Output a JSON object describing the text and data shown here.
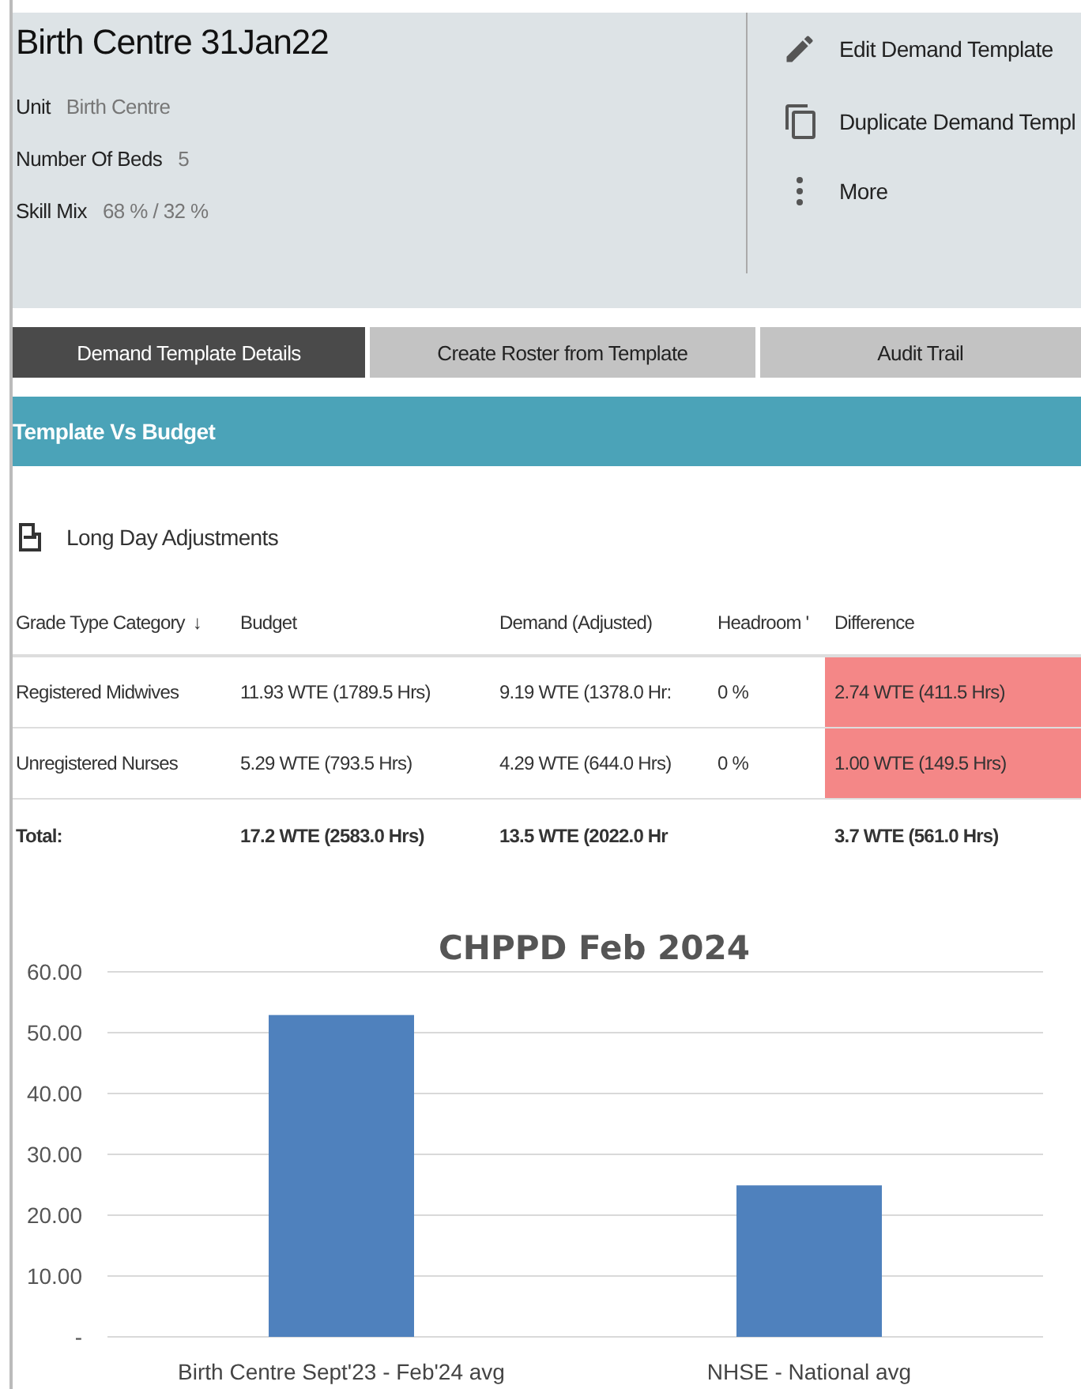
{
  "header": {
    "title": "Birth Centre 31Jan22",
    "fields": [
      {
        "label": "Unit",
        "value": "Birth Centre"
      },
      {
        "label": "Number Of Beds",
        "value": "5"
      },
      {
        "label": "Skill Mix",
        "value": "68 % / 32 %"
      }
    ],
    "actions": [
      {
        "kind": "edit",
        "label": "Edit Demand Template"
      },
      {
        "kind": "duplicate",
        "label": "Duplicate Demand Templ"
      },
      {
        "kind": "more",
        "label": "More"
      }
    ]
  },
  "tabs": [
    {
      "label": "Demand Template Details",
      "selected": true
    },
    {
      "label": "Create Roster from Template",
      "selected": false
    },
    {
      "label": "Audit Trail",
      "selected": false
    }
  ],
  "section": {
    "title": "Template Vs Budget",
    "toggle": "Long Day Adjustments"
  },
  "table": {
    "columns": [
      "Grade Type Category",
      "Budget",
      "Demand (Adjusted)",
      "Headroom '",
      "Difference"
    ],
    "sort_arrow": "↓",
    "rows": [
      {
        "cells": [
          "Registered Midwives",
          "11.93 WTE (1789.5 Hrs)",
          "9.19 WTE (1378.0 Hr:",
          "0 %",
          "2.74 WTE (411.5 Hrs)"
        ],
        "highlighted": true
      },
      {
        "cells": [
          "Unregistered Nurses",
          "5.29 WTE (793.5 Hrs)",
          "4.29 WTE (644.0 Hrs)",
          "0 %",
          "1.00 WTE (149.5 Hrs)"
        ],
        "highlighted": true
      }
    ],
    "total": {
      "label": "Total:",
      "budget": "17.2 WTE (2583.0 Hrs)",
      "demand": "13.5 WTE (2022.0 Hr",
      "difference": "3.7 WTE (561.0 Hrs)"
    }
  },
  "chart": {
    "chart_data": {
      "type": "bar",
      "title": "CHPPD Feb 2024",
      "categories": [
        "Birth Centre Sept'23 - Feb'24 avg",
        "NHSE - National avg"
      ],
      "series": [
        {
          "color": "#4f81bd",
          "values": [
            52.9,
            24.9
          ]
        }
      ],
      "ylim": [
        0,
        60
      ],
      "grid": true,
      "yticks": [
        {
          "value": 0,
          "label": "-"
        },
        {
          "value": 10,
          "label": "10.00"
        },
        {
          "value": 20,
          "label": "20.00"
        },
        {
          "value": 30,
          "label": "30.00"
        },
        {
          "value": 40,
          "label": "40.00"
        },
        {
          "value": 50,
          "label": "50.00"
        },
        {
          "value": 60,
          "label": "60.00"
        }
      ]
    }
  }
}
